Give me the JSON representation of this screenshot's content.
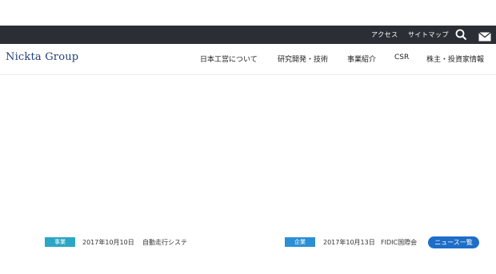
{
  "topbar": {
    "links": [
      "アクセス",
      "サイトマップ"
    ],
    "icons": [
      "search-icon",
      "mail-icon"
    ]
  },
  "header": {
    "logo": "Nickta Group",
    "nav": [
      "日本工営について",
      "研究開発・技術",
      "事業紹介",
      "CSR",
      "株主・投資家情報"
    ]
  },
  "news": {
    "items": [
      {
        "badge": "事業",
        "badge_color": "#2ba6c4",
        "date": "2017年10月10日",
        "title": "自動走行システ"
      },
      {
        "badge": "企業",
        "badge_color": "#2b8fd6",
        "date": "2017年10月13日",
        "title": "FIDIC国際会"
      }
    ],
    "list_button": "ニュース一覧"
  }
}
